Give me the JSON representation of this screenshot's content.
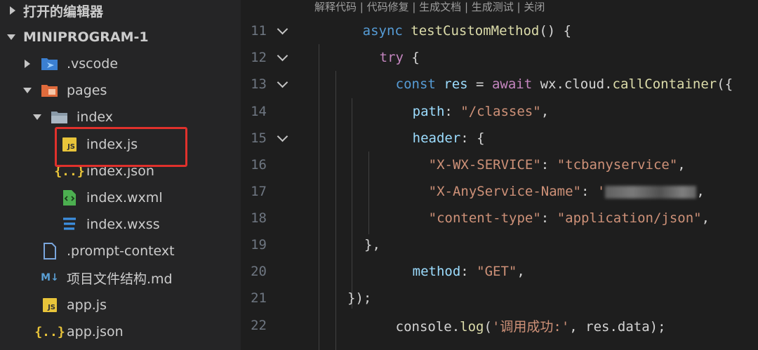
{
  "sidebar": {
    "open_editors_label": "打开的编辑器",
    "project_label": "MINIPROGRAM-1",
    "items": [
      {
        "label": ".vscode",
        "icon": "vscode-folder-icon"
      },
      {
        "label": "pages",
        "icon": "pages-folder-icon"
      },
      {
        "label": "index",
        "icon": "folder-open-icon"
      },
      {
        "label": "index.js",
        "icon": "js-file-icon",
        "badge": "JS"
      },
      {
        "label": "index.json",
        "icon": "json-file-icon",
        "badge": "{..}"
      },
      {
        "label": "index.wxml",
        "icon": "wxml-file-icon"
      },
      {
        "label": "index.wxss",
        "icon": "css-file-icon"
      },
      {
        "label": ".prompt-context",
        "icon": "file-icon"
      },
      {
        "label": "项目文件结构.md",
        "icon": "markdown-file-icon",
        "badge": "M↓"
      },
      {
        "label": "app.js",
        "icon": "js-file-icon",
        "badge": "JS"
      },
      {
        "label": "app.json",
        "icon": "json-file-icon",
        "badge": "{..}"
      }
    ]
  },
  "editor": {
    "codelens": "解释代码 | 代码修复 | 生成文档 | 生成测试 | 关闭",
    "line_numbers": [
      "11",
      "12",
      "13",
      "14",
      "15",
      "16",
      "17",
      "18",
      "19",
      "20",
      "21",
      "22"
    ],
    "tokens": {
      "l11_async": "async",
      "l11_fn": "testCustomMethod",
      "l11_rest": "() {",
      "l12_try": "try",
      "l12_rest": " {",
      "l13_const": "const",
      "l13_res": " res ",
      "l13_eq": "= ",
      "l13_await": "await",
      "l13_wx": " wx.cloud.",
      "l13_call": "callContainer",
      "l13_rest": "({",
      "l14_key": "path",
      "l14_colon": ": ",
      "l14_val": "\"/classes\"",
      "l14_end": ",",
      "l15_key": "header",
      "l15_rest": ": {",
      "l16_key": "\"X-WX-SERVICE\"",
      "l16_colon": ": ",
      "l16_val": "\"tcbanyservice\"",
      "l16_end": ",",
      "l17_key": "\"X-AnyService-Name\"",
      "l17_colon": ": ",
      "l17_val": "'",
      "l17_end": ",",
      "l18_key": "\"content-type\"",
      "l18_colon": ": ",
      "l18_val": "\"application/json\"",
      "l18_end": ",",
      "l19": "},",
      "l20_key": "method",
      "l20_colon": ": ",
      "l20_val": "\"GET\"",
      "l20_end": ",",
      "l21": "});",
      "l22_obj": "console.",
      "l22_fn": "log",
      "l22_p": "(",
      "l22_str": "'调用成功:'",
      "l22_rest": ", res.data);"
    }
  }
}
